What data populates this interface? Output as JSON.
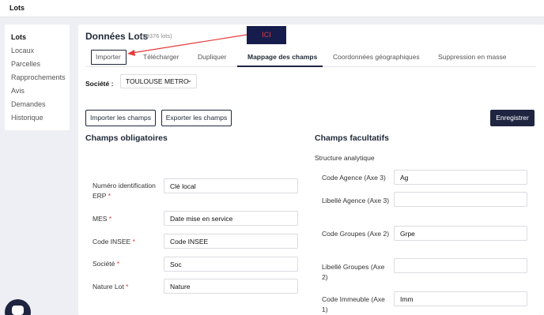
{
  "topbar": {
    "title": "Lots"
  },
  "sidebar": {
    "items": [
      {
        "label": "Lots",
        "active": true
      },
      {
        "label": "Locaux"
      },
      {
        "label": "Parcelles"
      },
      {
        "label": "Rapprochements"
      },
      {
        "label": "Avis"
      },
      {
        "label": "Demandes"
      },
      {
        "label": "Historique"
      }
    ]
  },
  "main": {
    "title": "Données Lots",
    "count": "(39376 lots)",
    "tabs": [
      {
        "label": "Importer"
      },
      {
        "label": "Télécharger"
      },
      {
        "label": "Dupliquer"
      },
      {
        "label": "Mappage des champs",
        "active": true
      },
      {
        "label": "Coordonnées géographiques"
      },
      {
        "label": "Suppression en masse"
      }
    ],
    "annotation": "ICI",
    "societe_label": "Société :",
    "societe_value": "TOULOUSE METRO",
    "import_button": "Importer les champs",
    "export_button": "Exporter les champs",
    "save_button": "Enregistrer",
    "required_title": "Champs obligatoires",
    "optional_title": "Champs facultatifs",
    "optional_subtitle": "Structure analytique",
    "required_fields": [
      {
        "label": "Numéro identification ERP",
        "star": "*",
        "value": "Clé local"
      },
      {
        "label": "MES",
        "star": "*",
        "value": "Date mise en service"
      },
      {
        "label": "Code INSEE",
        "star": "*",
        "value": "Code INSEE"
      },
      {
        "label": "Société",
        "star": "*",
        "value": "Soc"
      },
      {
        "label": "Nature Lot",
        "star": "*",
        "value": "Nature"
      }
    ],
    "optional_fields": [
      {
        "label": "Code Agence (Axe 3)",
        "value": "Ag"
      },
      {
        "label": "Libellé Agence (Axe 3)",
        "value": ""
      },
      {
        "label": "Code Groupes (Axe 2)",
        "value": "Grpe"
      },
      {
        "label": "Libellé Groupes (Axe 2)",
        "value": ""
      },
      {
        "label": "Code Immeuble (Axe 1)",
        "value": "Imm"
      }
    ]
  },
  "colors": {
    "primary": "#1f2540",
    "required_star": "#e53b3b",
    "annotation_text": "#e53b3b"
  },
  "icons": {
    "chat": "chat-bubble-icon",
    "select_chevron": "chevron-down-icon",
    "annotation_arrow": "red-arrow"
  }
}
